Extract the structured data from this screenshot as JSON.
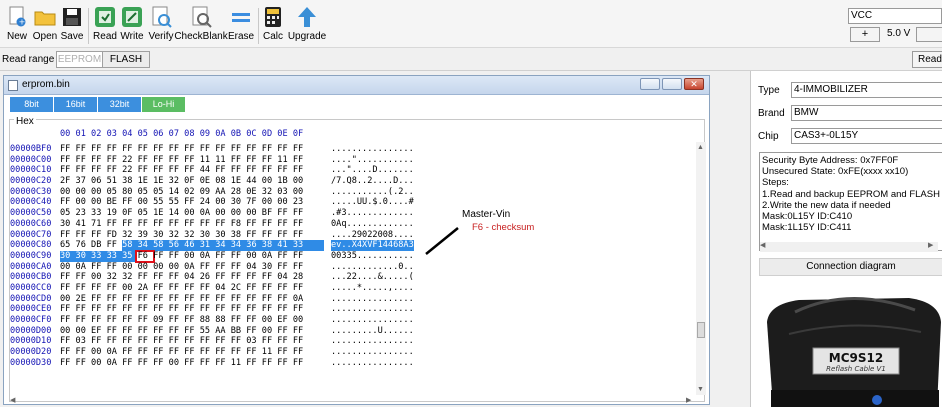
{
  "toolbar": {
    "buttons": [
      {
        "label": "New",
        "icon": "new-file-icon"
      },
      {
        "label": "Open",
        "icon": "folder-icon"
      },
      {
        "label": "Save",
        "icon": "floppy-icon"
      },
      {
        "label": "Read",
        "icon": "read-chip-icon"
      },
      {
        "label": "Write",
        "icon": "write-chip-icon"
      },
      {
        "label": "Verify",
        "icon": "verify-icon"
      },
      {
        "label": "CheckBlank",
        "icon": "checkblank-icon"
      },
      {
        "label": "Erase",
        "icon": "erase-icon"
      },
      {
        "label": "Calc",
        "icon": "calculator-icon"
      },
      {
        "label": "Upgrade",
        "icon": "upgrade-arrow-icon"
      }
    ],
    "voltage_select": "VCC",
    "plus_label": "+",
    "voltage_value": "5.0 V"
  },
  "read_range": {
    "label": "Read range",
    "options": [
      "EEPROM",
      "FLASH"
    ],
    "read_button": "Read"
  },
  "editor": {
    "file_name": "erprom.bin",
    "tabs": [
      "8bit",
      "16bit",
      "32bit",
      "Lo-Hi"
    ],
    "group_label": "Hex",
    "column_header": "00 01 02 03 04 05 06 07 08 09 0A 0B 0C 0D 0E 0F",
    "rows": [
      {
        "addr": "00000BF0",
        "bytes": "FF FF FF FF FF FF FF FF FF FF FF FF FF FF FF FF",
        "ascii": "................"
      },
      {
        "addr": "00000C00",
        "bytes": "FF FF FF FF 22 FF FF FF FF 11 11 FF FF FF 11 FF",
        "ascii": "....\"..........."
      },
      {
        "addr": "00000C10",
        "bytes": "FF FF FF FF 22 FF FF FF FF 44 FF FF FF FF FF FF",
        "ascii": "...\"....D......."
      },
      {
        "addr": "00000C20",
        "bytes": "2F 37 06 51 38 1E 1E 32 0F 0E 08 1E 44 00 1B 00",
        "ascii": "/7.Q8..2....D..."
      },
      {
        "addr": "00000C30",
        "bytes": "00 00 00 05 80 05 05 14 02 09 AA 28 0E 32 03 00",
        "ascii": "...........(.2.."
      },
      {
        "addr": "00000C40",
        "bytes": "FF 00 00 BE FF 00 55 55 FF 24 00 30 7F 00 00 23",
        "ascii": ".....UU.$.0....#"
      },
      {
        "addr": "00000C50",
        "bytes": "05 23 33 19 0F 05 1E 14 00 0A 00 00 00 BF FF FF",
        "ascii": ".#3............."
      },
      {
        "addr": "00000C60",
        "bytes": "30 41 71 FF FF FF FF FF FF FF FF F8 FF FF FF FF",
        "ascii": "0Aq............."
      },
      {
        "addr": "00000C70",
        "bytes": "FF FF FF FD 32 39 30 32 32 30 30 38 FF FF FF FF",
        "ascii": "....29022008...."
      },
      {
        "addr": "00000C80",
        "bytes": "65 76 DB FF 58 34 58 56 46 31 34 34 36 38 41 33",
        "ascii": "ev..X4XVF14468A3"
      },
      {
        "addr": "00000C90",
        "bytes": "30 30 33 33 35 F6 FF FF 00 0A FF FF 00 0A FF FF",
        "ascii": "00335..........."
      },
      {
        "addr": "00000CA0",
        "bytes": "00 0A FF FF 00 00 00 00 0A FF FF FF 04 30 FF FF",
        "ascii": ".............0.."
      },
      {
        "addr": "00000CB0",
        "bytes": "FF FF 00 32 32 FF FF FF 04 26 FF FF FF FF 04 28",
        "ascii": "...22....&.....("
      },
      {
        "addr": "00000CC0",
        "bytes": "FF FF FF FF 00 2A FF FF FF FF 04 2C FF FF FF FF",
        "ascii": ".....*.....,...."
      },
      {
        "addr": "00000CD0",
        "bytes": "00 2E FF FF FF FF FF FF FF FF FF FF FF FF FF 0A",
        "ascii": "................"
      },
      {
        "addr": "00000CE0",
        "bytes": "FF FF FF FF FF FF FF FF FF FF FF FF FF FF FF FF",
        "ascii": "................"
      },
      {
        "addr": "00000CF0",
        "bytes": "FF FF FF FF FF FF 09 FF FF 88 88 FF FF 00 EF 00",
        "ascii": "................"
      },
      {
        "addr": "00000D00",
        "bytes": "00 00 EF FF FF FF FF FF FF 55 AA BB FF 00 FF FF",
        "ascii": ".........U......"
      },
      {
        "addr": "00000D10",
        "bytes": "FF 03 FF FF FF FF FF FF FF FF FF FF 03 FF FF FF",
        "ascii": "................"
      },
      {
        "addr": "00000D20",
        "bytes": "FF FF 00 0A FF FF FF FF FF FF FF FF FF 11 FF FF",
        "ascii": "................"
      },
      {
        "addr": "00000D30",
        "bytes": "FF FF 00 0A FF FF FF 00 FF FF FF 11 FF FF FF FF",
        "ascii": "................"
      }
    ]
  },
  "annotation": {
    "title": "Master-Vin",
    "subtitle": "F6 - checksum"
  },
  "right_panel": {
    "type_label": "Type",
    "type_value": "4-IMMOBILIZER",
    "brand_label": "Brand",
    "brand_value": "BMW",
    "chip_label": "Chip",
    "chip_value": "CAS3+-0L15Y",
    "info_lines": [
      "Security Byte Address: 0x7FF0F",
      "Unsecured State: 0xFE(xxxx xx10)",
      "Steps:",
      "1.Read and backup EEPROM and FLASH d",
      "2.Write the new data if needed",
      "Mask:0L15Y ID:C410",
      "Mask:1L15Y ID:C411"
    ],
    "connection_button": "Connection diagram",
    "cable_label": "MC9S12",
    "cable_sublabel": "Reflash Cable V1"
  }
}
